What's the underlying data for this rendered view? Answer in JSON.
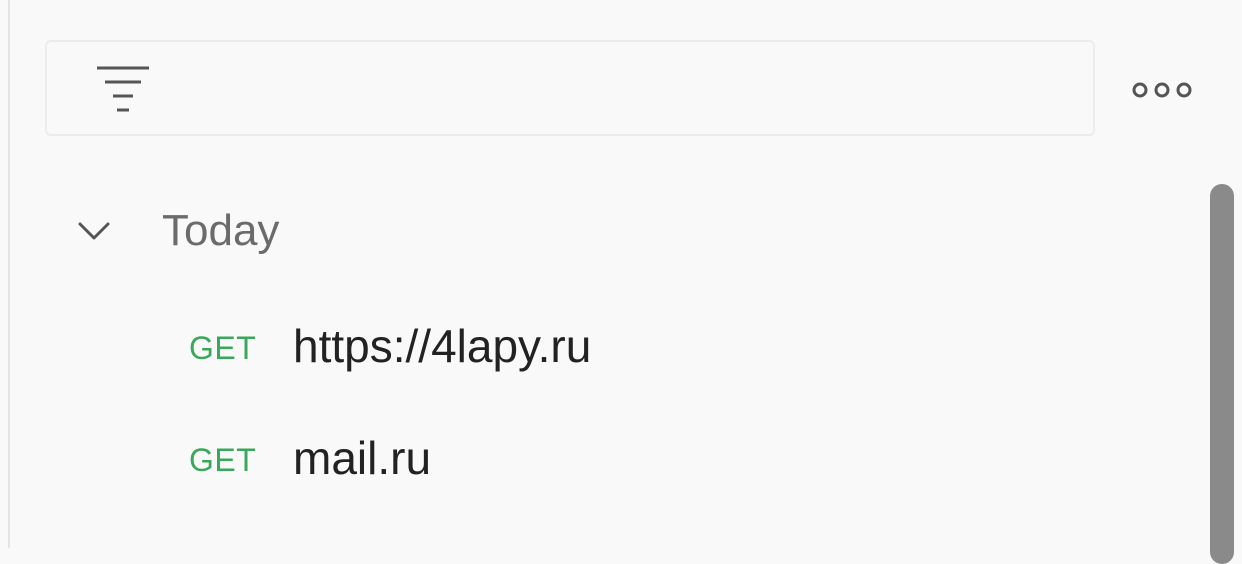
{
  "history": {
    "groups": [
      {
        "label": "Today",
        "expanded": true,
        "items": [
          {
            "method": "GET",
            "url": "https://4lapy.ru"
          },
          {
            "method": "GET",
            "url": "mail.ru"
          }
        ]
      }
    ]
  },
  "icons": {
    "filter": "filter-icon",
    "more": "more-options-icon",
    "chevron": "chevron-down-icon"
  },
  "colors": {
    "method_get": "#3aa85a",
    "url_text": "#222222",
    "group_label": "#6b6b6b",
    "background": "#f9f9f9"
  }
}
